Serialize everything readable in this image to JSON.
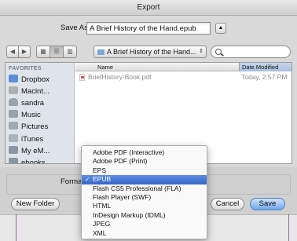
{
  "window": {
    "title": "Export"
  },
  "save_as": {
    "label": "Save As:",
    "value": "A Brief History of the Hand.epub"
  },
  "toolbar": {
    "location": "A Brief History of the Hand...",
    "search_placeholder": ""
  },
  "sidebar": {
    "header": "FAVORITES",
    "items": [
      {
        "label": "Dropbox",
        "icon": "dropbox-icon"
      },
      {
        "label": "Macint...",
        "icon": "hard-drive-icon"
      },
      {
        "label": "sandra",
        "icon": "home-icon"
      },
      {
        "label": "Music",
        "icon": "music-icon"
      },
      {
        "label": "Pictures",
        "icon": "pictures-icon"
      },
      {
        "label": "iTunes",
        "icon": "itunes-icon"
      },
      {
        "label": "My eM...",
        "icon": "folder-icon"
      },
      {
        "label": "ebooks",
        "icon": "folder-icon"
      }
    ]
  },
  "file_list": {
    "columns": {
      "name": "Name",
      "date": "Date Modified"
    },
    "files": [
      {
        "name": "BriefHistory-Book.pdf",
        "date": "Today, 2:57 PM"
      }
    ]
  },
  "format": {
    "label": "Format",
    "options": [
      "Adobe PDF (Interactive)",
      "Adobe PDF (Print)",
      "EPS",
      "EPUB",
      "Flash CS5 Professional (FLA)",
      "Flash Player (SWF)",
      "HTML",
      "InDesign Markup (IDML)",
      "JPEG",
      "XML"
    ],
    "selected": "EPUB"
  },
  "buttons": {
    "new_folder": "New Folder",
    "cancel": "Cancel",
    "save": "Save"
  }
}
